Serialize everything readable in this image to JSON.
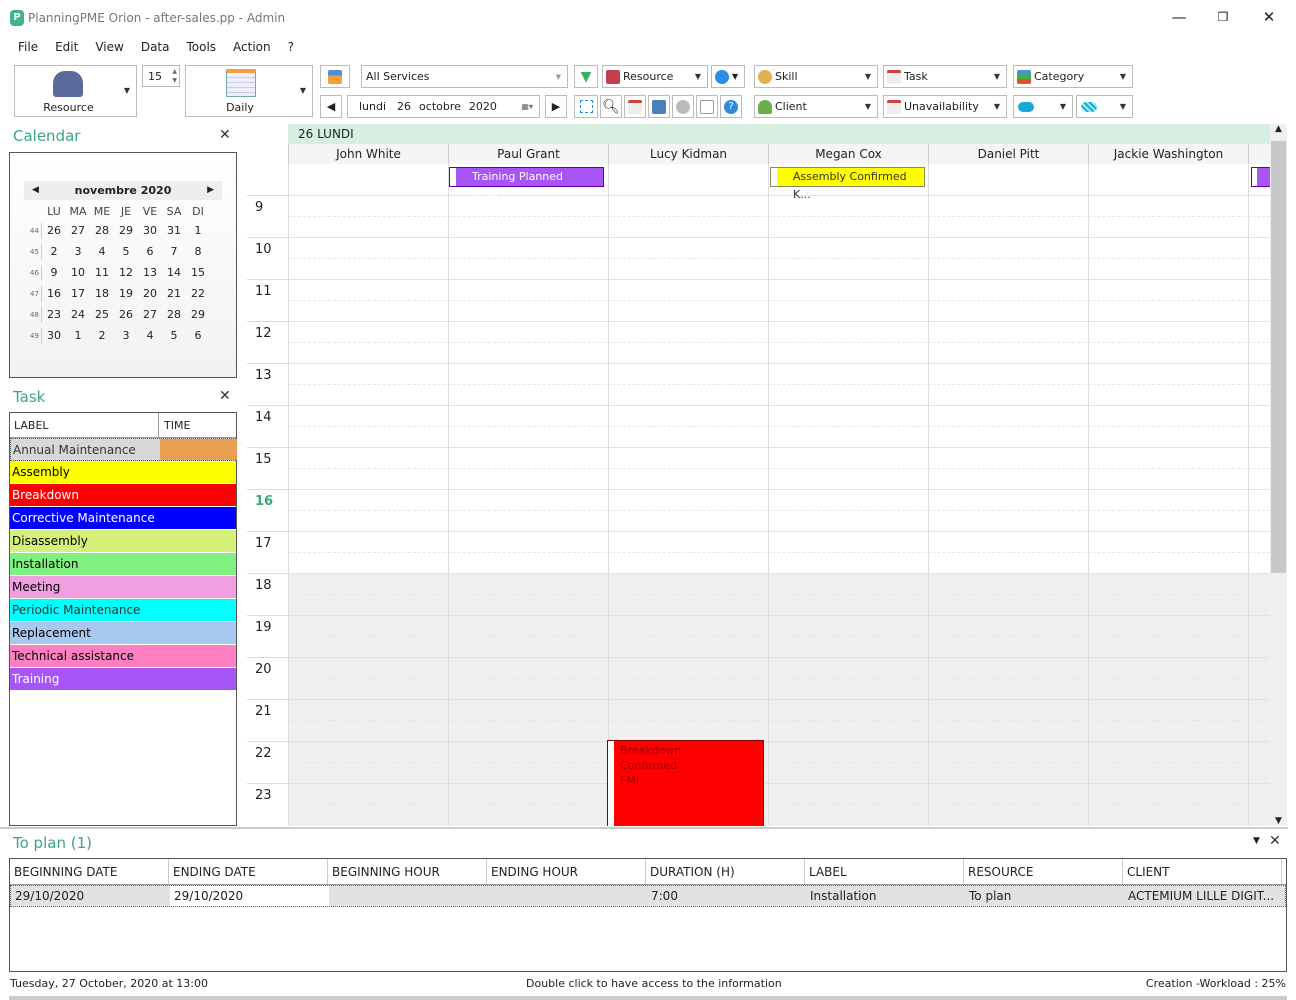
{
  "window": {
    "title": "PlanningPME Orion - after-sales.pp - Admin",
    "minimize": "—",
    "restore": "❐",
    "close": "✕"
  },
  "menu": [
    "File",
    "Edit",
    "View",
    "Data",
    "Tools",
    "Action",
    "?"
  ],
  "toolbar": {
    "resource_label": "Resource",
    "spin_value": "15",
    "daily_label": "Daily",
    "services": "All Services",
    "resource_filter": "Resource",
    "skill": "Skill",
    "task": "Task",
    "category": "Category",
    "client": "Client",
    "unavailability": "Unavailability",
    "date": {
      "day_name": "lundi",
      "day": "26",
      "month": "octobre",
      "year": "2020"
    }
  },
  "calendar": {
    "title": "Calendar",
    "month": "novembre 2020",
    "days": [
      "LU",
      "MA",
      "ME",
      "JE",
      "VE",
      "SA",
      "DI"
    ],
    "weeks": [
      {
        "wk": "44",
        "d": [
          "26",
          "27",
          "28",
          "29",
          "30",
          "31",
          "1"
        ]
      },
      {
        "wk": "45",
        "d": [
          "2",
          "3",
          "4",
          "5",
          "6",
          "7",
          "8"
        ]
      },
      {
        "wk": "46",
        "d": [
          "9",
          "10",
          "11",
          "12",
          "13",
          "14",
          "15"
        ]
      },
      {
        "wk": "47",
        "d": [
          "16",
          "17",
          "18",
          "19",
          "20",
          "21",
          "22"
        ]
      },
      {
        "wk": "48",
        "d": [
          "23",
          "24",
          "25",
          "26",
          "27",
          "28",
          "29"
        ]
      },
      {
        "wk": "49",
        "d": [
          "30",
          "1",
          "2",
          "3",
          "4",
          "5",
          "6"
        ]
      }
    ]
  },
  "tasks": {
    "title": "Task",
    "col_label": "LABEL",
    "col_time": "TIME",
    "items": [
      {
        "label": "Annual Maintenance",
        "color": "#d8d8d8",
        "fg": "#333"
      },
      {
        "label": "Assembly",
        "color": "#ffff00",
        "fg": "#000"
      },
      {
        "label": "Breakdown",
        "color": "#ff0000",
        "fg": "#fff"
      },
      {
        "label": "Corrective Maintenance",
        "color": "#0000ff",
        "fg": "#fff"
      },
      {
        "label": "Disassembly",
        "color": "#d4f078",
        "fg": "#000"
      },
      {
        "label": "Installation",
        "color": "#80f080",
        "fg": "#000"
      },
      {
        "label": "Meeting",
        "color": "#f0a0e0",
        "fg": "#000"
      },
      {
        "label": "Periodic Maintenance",
        "color": "#00ffff",
        "fg": "#333"
      },
      {
        "label": "Replacement",
        "color": "#a8c8f0",
        "fg": "#000"
      },
      {
        "label": "Technical assistance",
        "color": "#ff80c0",
        "fg": "#000"
      },
      {
        "label": "Training",
        "color": "#a855f7",
        "fg": "#fff"
      }
    ]
  },
  "planning": {
    "day_header": "26 LUNDI",
    "resources": [
      "John White",
      "Paul Grant",
      "Lucy Kidman",
      "Megan Cox",
      "Daniel Pitt",
      "Jackie Washington"
    ],
    "hours": [
      "9",
      "10",
      "11",
      "12",
      "13",
      "14",
      "15",
      "16",
      "17",
      "18",
      "19",
      "20",
      "21",
      "22",
      "23"
    ],
    "current_hour": "16",
    "allday_events": [
      {
        "text": "Training Planned DENG...",
        "color": "#a855f7",
        "fg": "#fff"
      },
      {
        "text": "Assembly Confirmed K...",
        "color": "#ffff00",
        "fg": "#333"
      }
    ],
    "events": [
      {
        "lines": [
          "Breakdown",
          "Confirmed",
          "FMI"
        ],
        "color": "#ff0000"
      }
    ]
  },
  "toplan": {
    "title": "To plan (1)",
    "columns": [
      "BEGINNING DATE",
      "ENDING DATE",
      "BEGINNING HOUR",
      "ENDING HOUR",
      "DURATION (H)",
      "LABEL",
      "RESOURCE",
      "CLIENT"
    ],
    "rows": [
      [
        "29/10/2020",
        "29/10/2020",
        "",
        "",
        "7:00",
        "Installation",
        "To plan",
        "ACTEMIUM LILLE DIGIT..."
      ]
    ]
  },
  "status": {
    "left": "Tuesday, 27 October, 2020 at 13:00",
    "center": "Double click to have access to the information",
    "right": "Creation -Workload : 25%"
  }
}
